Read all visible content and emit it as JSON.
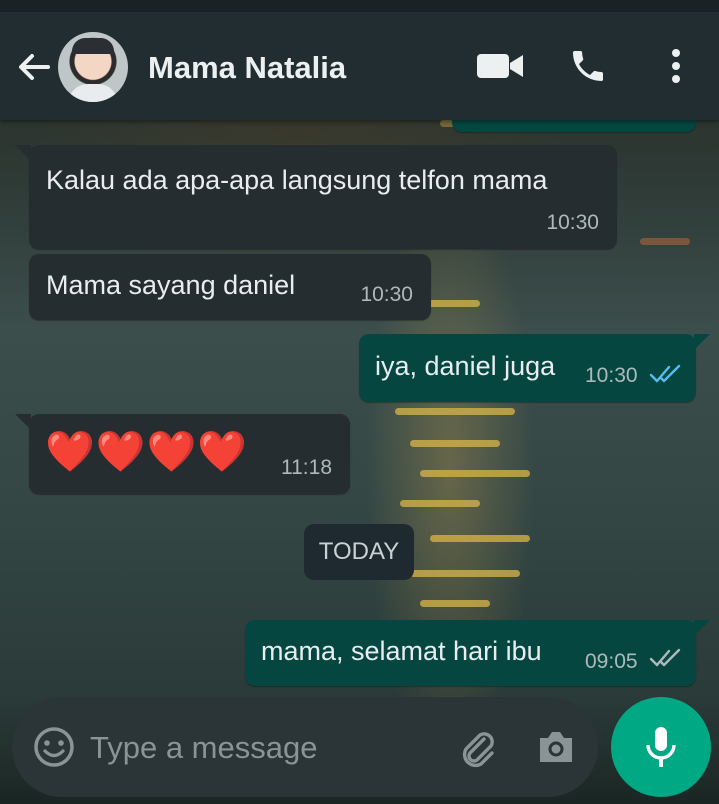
{
  "header": {
    "contact_name": "Mama Natalia",
    "icons": [
      "back-arrow-icon",
      "avatar",
      "video-call-icon",
      "phone-icon",
      "more-options-icon"
    ]
  },
  "messages": [
    {
      "direction": "in",
      "text": "Kalau ada apa-apa langsung telfon mama",
      "time": "10:30"
    },
    {
      "direction": "in",
      "text": "Mama sayang daniel",
      "time": "10:30"
    },
    {
      "direction": "out",
      "text": "iya, daniel juga",
      "time": "10:30",
      "status": "read"
    },
    {
      "direction": "in",
      "text": "❤️❤️❤️❤️",
      "time": "11:18"
    },
    {
      "direction": "out",
      "text": "mama, selamat hari ibu",
      "time": "09:05",
      "status": "delivered"
    }
  ],
  "date_separator": "TODAY",
  "composer": {
    "placeholder": "Type a message",
    "icons": [
      "emoji-icon",
      "attach-icon",
      "camera-icon",
      "mic-icon"
    ]
  },
  "colors": {
    "header_bg": "#222d31",
    "incoming_bubble": "#262d31",
    "outgoing_bubble": "#054740",
    "accent": "#00a884",
    "read_ticks": "#53bdeb"
  }
}
